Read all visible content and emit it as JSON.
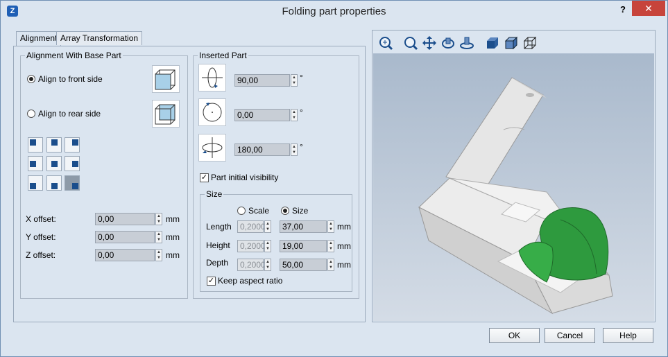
{
  "window": {
    "title": "Folding part properties",
    "help_glyph": "?",
    "close_glyph": "✕"
  },
  "tabs": [
    {
      "label": "Alignment",
      "active": true
    },
    {
      "label": "Array Transformation",
      "active": false
    }
  ],
  "alignment_group": {
    "legend": "Alignment With Base Part",
    "align_front_label": "Align to front side",
    "align_rear_label": "Align to rear side",
    "selected": "front"
  },
  "offsets": {
    "x_label": "X offset:",
    "y_label": "Y offset:",
    "z_label": "Z offset:",
    "x_value": "0,00",
    "y_value": "0,00",
    "z_value": "0,00",
    "unit": "mm"
  },
  "inserted_part": {
    "legend": "Inserted Part",
    "rot1": "90,00",
    "rot2": "0,00",
    "rot3": "180,00",
    "degree": "°",
    "visibility_label": "Part initial visibility",
    "visibility_checked": true
  },
  "size": {
    "legend": "Size",
    "scale_label": "Scale",
    "size_label": "Size",
    "mode": "size",
    "length_label": "Length",
    "height_label": "Height",
    "depth_label": "Depth",
    "length_scale": "0,2000",
    "height_scale": "0,2000",
    "depth_scale": "0,2000",
    "length_value": "37,00",
    "height_value": "19,00",
    "depth_value": "50,00",
    "unit": "mm",
    "keep_aspect_label": "Keep aspect ratio",
    "keep_aspect_checked": true
  },
  "footer": {
    "ok_label": "OK",
    "cancel_label": "Cancel",
    "help_label": "Help"
  },
  "colors": {
    "accent": "#1b4e8c",
    "close_button": "#c7443b",
    "cap": "#2e9a3e",
    "box": "#e8e8e8"
  }
}
